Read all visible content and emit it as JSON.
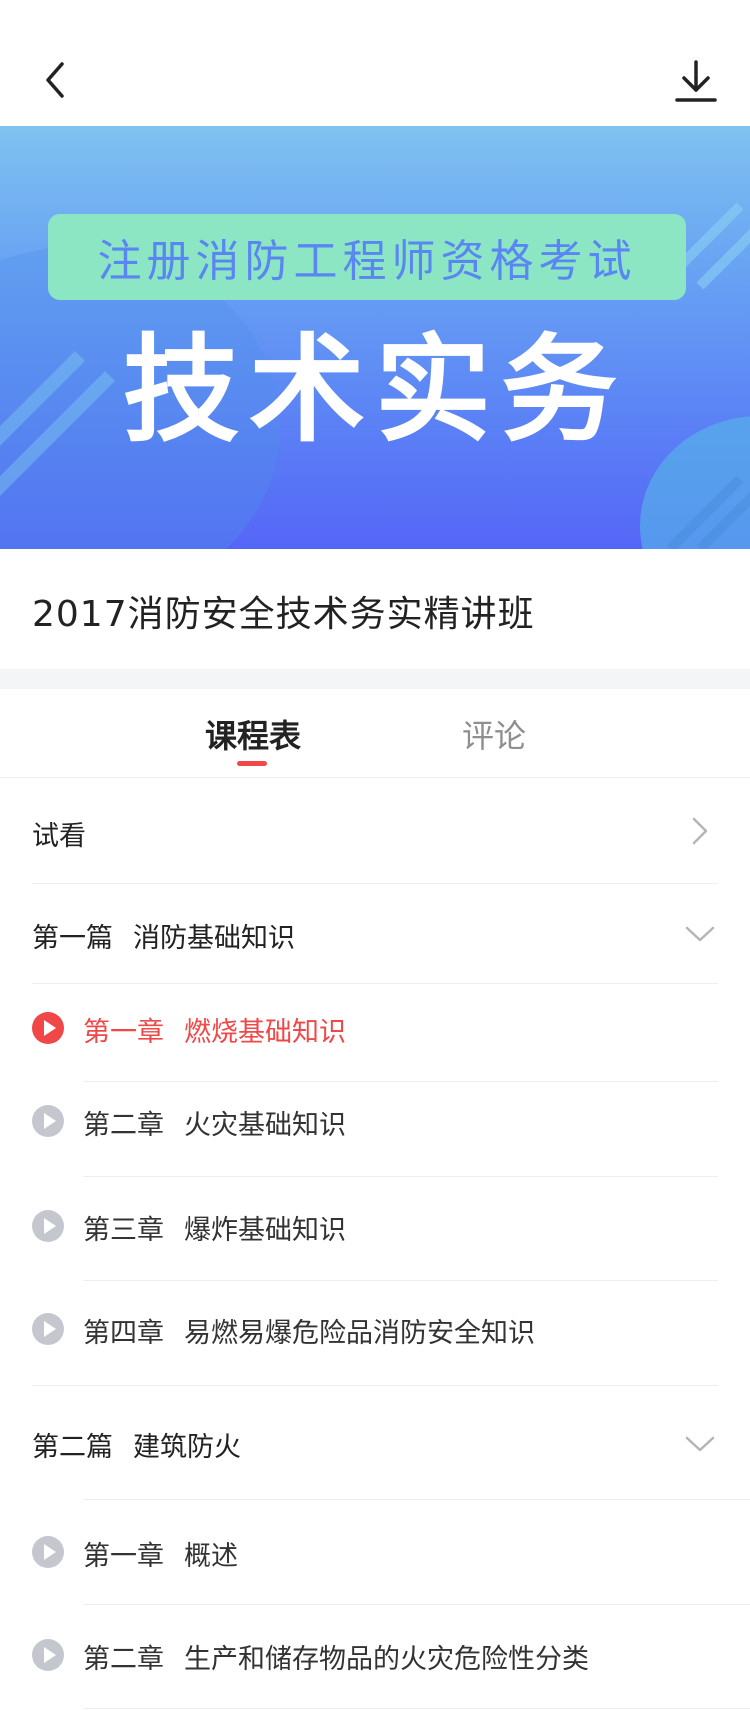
{
  "topbar": {
    "back_icon": "chevron-left-icon",
    "download_icon": "download-icon"
  },
  "banner": {
    "subtitle": "注册消防工程师资格考试",
    "title": "技术实务",
    "colors": {
      "bg_top": "#80c2ef",
      "bg_bottom": "#5566f7",
      "subtitle_bg": "#8ce6c4"
    }
  },
  "course": {
    "title": "2017消防安全技术务实精讲班"
  },
  "tabs": [
    {
      "label": "课程表",
      "active": true
    },
    {
      "label": "评论",
      "active": false
    }
  ],
  "preview": {
    "label": "试看"
  },
  "sections": [
    {
      "title": "第一篇",
      "name": "消防基础知识",
      "chapters": [
        {
          "num": "第一章",
          "name": "燃烧基础知识",
          "active": true
        },
        {
          "num": "第二章",
          "name": "火灾基础知识",
          "active": false
        },
        {
          "num": "第三章",
          "name": "爆炸基础知识",
          "active": false
        },
        {
          "num": "第四章",
          "name": "易燃易爆危险品消防安全知识",
          "active": false
        }
      ]
    },
    {
      "title": "第二篇",
      "name": "建筑防火",
      "chapters": [
        {
          "num": "第一章",
          "name": "概述",
          "active": false
        },
        {
          "num": "第二章",
          "name": "生产和储存物品的火灾危险性分类",
          "active": false
        }
      ]
    }
  ],
  "accent_color": "#f04848"
}
